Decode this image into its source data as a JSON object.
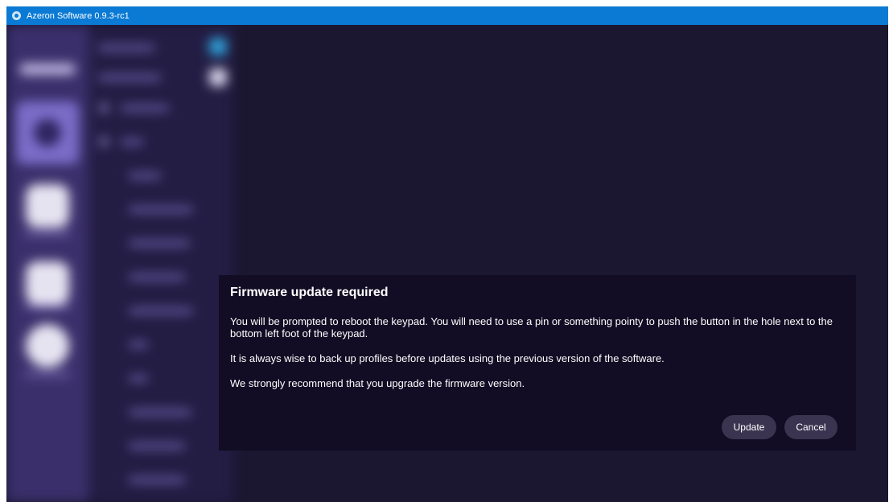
{
  "window": {
    "title": "Azeron Software 0.9.3-rc1"
  },
  "dialog": {
    "title": "Firmware update required",
    "paragraphs": [
      "You will be prompted to reboot the keypad. You will need to use a pin or something pointy to push the button in the hole next to the bottom left foot of the keypad.",
      "It is always wise to back up profiles before updates using the previous version of the software.",
      "We strongly recommend that you upgrade the firmware version."
    ],
    "update_label": "Update",
    "cancel_label": "Cancel"
  },
  "colors": {
    "titlebar": "#0a7ad4",
    "background": "#1b1731",
    "dialog_background": "#120c24",
    "button_background": "#3a3450",
    "rail_active": "#7b6cc8"
  },
  "icons": {
    "app": "azeron-logo-icon"
  }
}
